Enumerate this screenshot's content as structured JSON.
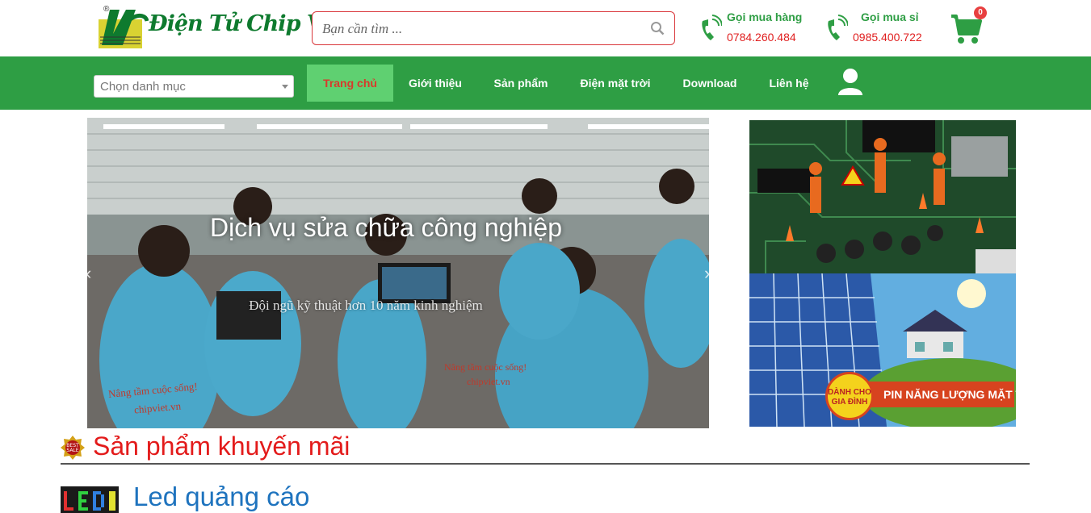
{
  "header": {
    "logo_text": "Điện Tử Chip Việt",
    "logo_mark": "®",
    "search_placeholder": "Bạn cần tìm ...",
    "hotlines": [
      {
        "label": "Gọi mua hàng",
        "number": "0784.260.484"
      },
      {
        "label": "Gọi mua sỉ",
        "number": "0985.400.722"
      }
    ],
    "cart_count": "0"
  },
  "nav": {
    "category_placeholder": "Chọn danh mục",
    "items": [
      {
        "label": "Trang chủ",
        "active": true
      },
      {
        "label": "Giới thiệu"
      },
      {
        "label": "Sản phẩm"
      },
      {
        "label": "Điện mặt trời"
      },
      {
        "label": "Download"
      },
      {
        "label": "Liên hệ"
      }
    ]
  },
  "slider": {
    "title": "Dịch vụ sửa chữa công nghiệp",
    "subtitle": "Đội ngũ kỹ thuật hơn 10 năm kinh nghiệm",
    "shirt_text_1": "Nâng tầm cuộc sống!",
    "shirt_text_2": "chipviet.vn",
    "prev": "‹",
    "next": "›"
  },
  "banners": {
    "solar_badge": "DÀNH CHO GIA ĐÌNH",
    "solar_tag": "PIN NĂNG LƯỢNG MẶT TRỜI"
  },
  "sections": {
    "promo_title": "Sản phẩm khuyến mãi",
    "led_title": "Led quảng cáo"
  },
  "colors": {
    "brand_green": "#2e9e44",
    "active_nav_bg": "#5fd071",
    "accent_red": "#e31b1b",
    "link_blue": "#1e73be"
  }
}
